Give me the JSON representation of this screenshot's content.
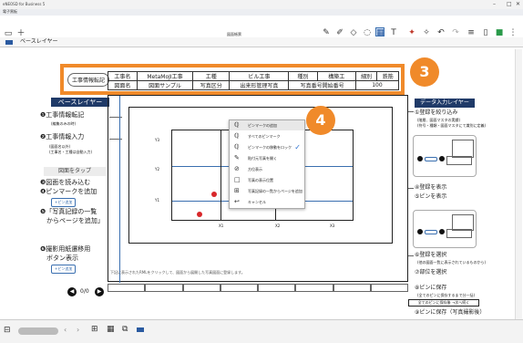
{
  "app": {
    "title": "eNEOSD for Business 5",
    "tab_label": "電子黒板",
    "doc_title": "図面帳票"
  },
  "layer": {
    "name": "ベースレイヤー"
  },
  "info_table": {
    "row1": [
      "工事名",
      "MetaMoJI工事",
      "工種",
      "ビル工事",
      "種別",
      "構築工",
      "細別",
      "鉄筋"
    ],
    "row2": [
      "図面名",
      "図面サンプル",
      "写真区分",
      "出来形管理写真",
      "写真番号開始番号",
      "100"
    ]
  },
  "left_panel": {
    "badge": "工事情報転記",
    "header": "ベースレイヤー",
    "items": [
      {
        "num": "❶",
        "title": "工事情報転記",
        "sub": "(編集のみの時)"
      },
      {
        "num": "❷",
        "title": "工事情報入力",
        "sub": "(図面名以外)\n(工事名・工種は自動入力)"
      }
    ],
    "tap_header": "図面をタップ",
    "tap_items": [
      "❸図面を読み込む",
      "❹ピンマークを追加",
      "❺「写真記録の一覧\n　からページを追加」"
    ],
    "pin_btn": "+ピン追加",
    "bottom_item": "❻撮影用紙遷移用\n　ボタン表示",
    "bottom_btn": "+ピン追加",
    "pager": "0/0"
  },
  "right_panel": {
    "header": "データ入力レイヤー",
    "items": [
      "①登録を絞り込み",
      "(階層、図面マスタの実績)",
      "(符号・種類・図面マスタにて識別に定義)",
      "④登録を表示",
      "⑤ピンを表示",
      "⑥登録を選択",
      "(他の図面一覧に表示されているものから)",
      "⑦部位を選択",
      "⑧ピンに保存",
      "(全てのピンに保存するまで分一括)",
      "全てのピンに保存後 →次へ続く",
      "⑨ピンに保存（写真撮影後）"
    ]
  },
  "drawing": {
    "axis_labels": [
      "Y3",
      "Y2",
      "Y1",
      "X1",
      "X2",
      "X3"
    ],
    "footer": "下記に表示されたRMLをクリックして、図面から展開した写真図面に登録します。"
  },
  "context_menu": {
    "items": [
      {
        "icon": "pin-icon",
        "label": "ピンマークの追加",
        "checked": false,
        "highlight": true
      },
      {
        "icon": "pin-list-icon",
        "label": "すべてのピンマーク",
        "checked": false,
        "highlight": false
      },
      {
        "icon": "pin-check-icon",
        "label": "ピンマークの移動をロック",
        "checked": true,
        "highlight": false
      },
      {
        "icon": "edit-pin-icon",
        "label": "貼付元写真を開く",
        "checked": false,
        "highlight": false
      },
      {
        "icon": "no-pin-icon",
        "label": "方位表示",
        "checked": false,
        "highlight": false
      },
      {
        "icon": "square-icon",
        "label": "写真の表示位置",
        "checked": false,
        "highlight": false
      },
      {
        "icon": "add-page-icon",
        "label": "写真記録の一覧からページを追加",
        "checked": false,
        "highlight": false
      },
      {
        "icon": "cancel-icon",
        "label": "キャンセル",
        "checked": false,
        "highlight": false
      }
    ]
  },
  "callouts": {
    "three": "3",
    "four": "4"
  },
  "colors": {
    "accent": "#f08a2a",
    "navy": "#1f3a68",
    "red": "#d8272a",
    "blue": "#3a6fb0"
  }
}
